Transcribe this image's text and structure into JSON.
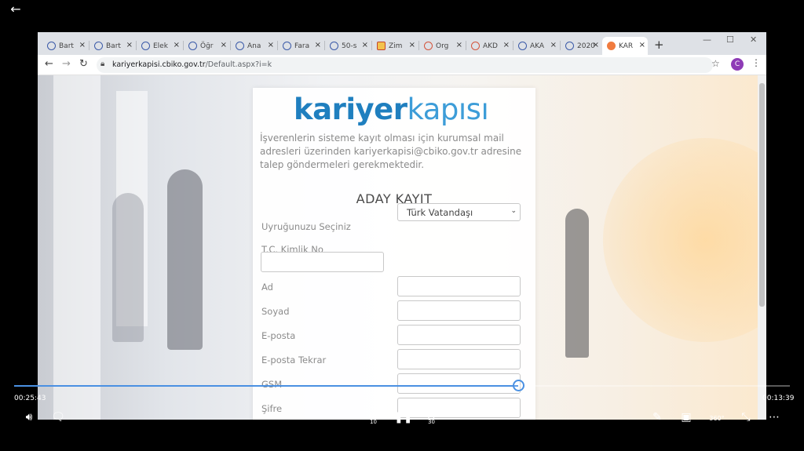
{
  "browser": {
    "tabs": [
      {
        "label": "Bart",
        "icon": "globe-icon"
      },
      {
        "label": "Bart",
        "icon": "globe-icon"
      },
      {
        "label": "Elek",
        "icon": "globe-icon"
      },
      {
        "label": "Öğr",
        "icon": "globe-icon"
      },
      {
        "label": "Ana",
        "icon": "globe-icon"
      },
      {
        "label": "Fara",
        "icon": "globe-icon"
      },
      {
        "label": "50-s",
        "icon": "globe-icon"
      },
      {
        "label": "Zim",
        "icon": "warning-icon"
      },
      {
        "label": "Org",
        "icon": "site-icon"
      },
      {
        "label": "AKD",
        "icon": "site-icon"
      },
      {
        "label": "AKA",
        "icon": "globe-icon"
      },
      {
        "label": "2020",
        "icon": "globe-icon"
      },
      {
        "label": "KAR",
        "icon": "orange-site-icon",
        "active": true
      }
    ],
    "tab_close": "×",
    "new_tab": "+",
    "window_controls": {
      "minimize": "—",
      "maximize": "☐",
      "close": "✕"
    },
    "url": {
      "host": "kariyerkapisi.cbiko.gov.tr",
      "path": "/Default.aspx?i=k"
    },
    "profile_initial": "C"
  },
  "page": {
    "logo": {
      "bold": "kariyer",
      "light": "kapısı"
    },
    "intro": "İşverenlerin sisteme kayıt olması için kurumsal mail adresleri üzerinden kariyerkapisi@cbiko.gov.tr adresine talep göndermeleri gerekmektedir.",
    "form_title": "ADAY KAYIT",
    "fields": {
      "nationality_label": "Uyruğunuzu Seçiniz",
      "nationality_value": "Türk Vatandaşı",
      "tc_label": "T.C. Kimlik No",
      "name_label": "Ad",
      "surname_label": "Soyad",
      "email_label": "E-posta",
      "email_repeat_label": "E-posta Tekrar",
      "gsm_label": "GSM",
      "password_label": "Şifre"
    }
  },
  "player": {
    "elapsed": "00:25:43",
    "remaining": "00:13:39",
    "progress": 0.65,
    "skip_back_seconds": "10",
    "skip_forward_seconds": "30",
    "view_360_label": "360°",
    "accent": "#4a90e2"
  }
}
